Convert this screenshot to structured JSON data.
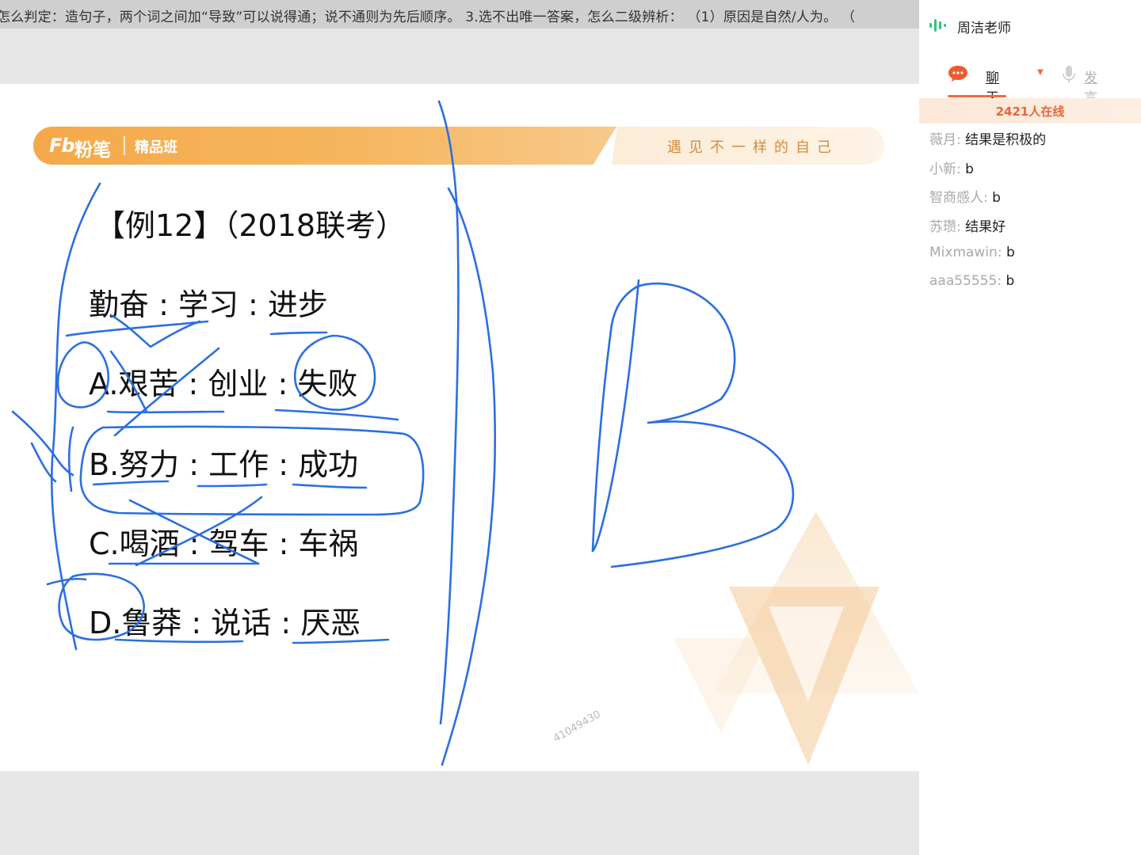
{
  "stage": {
    "marquee": "怎么判定：造句子，两个词之间加“导致”可以说得通；说不通则为先后顺序。 3.选不出唯一答案，怎么二级辨析：  （1）原因是自然/人为。  （"
  },
  "slide": {
    "brand_mark": "Fb",
    "brand_name": "粉笔",
    "class_label": "精品班",
    "slogan": "遇见不一样的自己",
    "question": {
      "title": "【例12】（2018联考）",
      "stem": "勤奋 : 学习 : 进步",
      "options": [
        "A.艰苦 : 创业 : 失败",
        "B.努力 : 工作 : 成功",
        "C.喝酒 : 驾车 : 车祸",
        "D.鲁莽 : 说话 : 厌恶"
      ]
    },
    "watermark_id": "41049430",
    "handwritten_answer": "B",
    "accent_color": "#f5a84a",
    "ink_color": "#2b6fe0"
  },
  "panel": {
    "teacher_name": "周洁老师",
    "tabs": {
      "chat": "聊天",
      "speak": "发言"
    },
    "online": "2421人在线",
    "messages": [
      {
        "user": "薇月:",
        "text": "结果是积极的"
      },
      {
        "user": "小新:",
        "text": "b"
      },
      {
        "user": "智商感人:",
        "text": "b"
      },
      {
        "user": "苏瓒:",
        "text": "结果好"
      },
      {
        "user": "Mixmawin:",
        "text": "b"
      },
      {
        "user": "aaa55555:",
        "text": "b"
      }
    ],
    "accent_color": "#f16a3b"
  }
}
